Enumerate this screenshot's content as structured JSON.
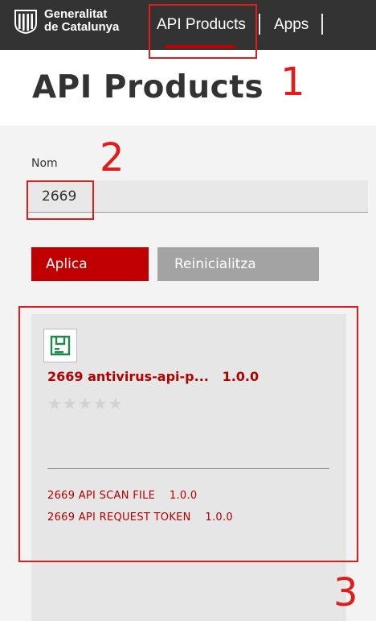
{
  "header": {
    "logo_line1": "Generalitat",
    "logo_line2": "de Catalunya",
    "nav": [
      {
        "label": "API Products"
      },
      {
        "label": "Apps"
      }
    ]
  },
  "page": {
    "title": "API Products"
  },
  "filter": {
    "label": "Nom",
    "value": "2669",
    "apply_label": "Aplica",
    "reset_label": "Reinicialitza"
  },
  "product": {
    "name": "2669 antivirus-api-p...",
    "version": "1.0.0",
    "stars": "★★★★★",
    "apis": [
      {
        "name": "2669 API SCAN FILE",
        "version": "1.0.0"
      },
      {
        "name": "2669 API REQUEST TOKEN",
        "version": "1.0.0"
      }
    ]
  },
  "annotations": [
    "1",
    "2",
    "3"
  ],
  "colors": {
    "accent": "#c00000",
    "annotation": "#e21b1b",
    "topbar": "#333333"
  }
}
